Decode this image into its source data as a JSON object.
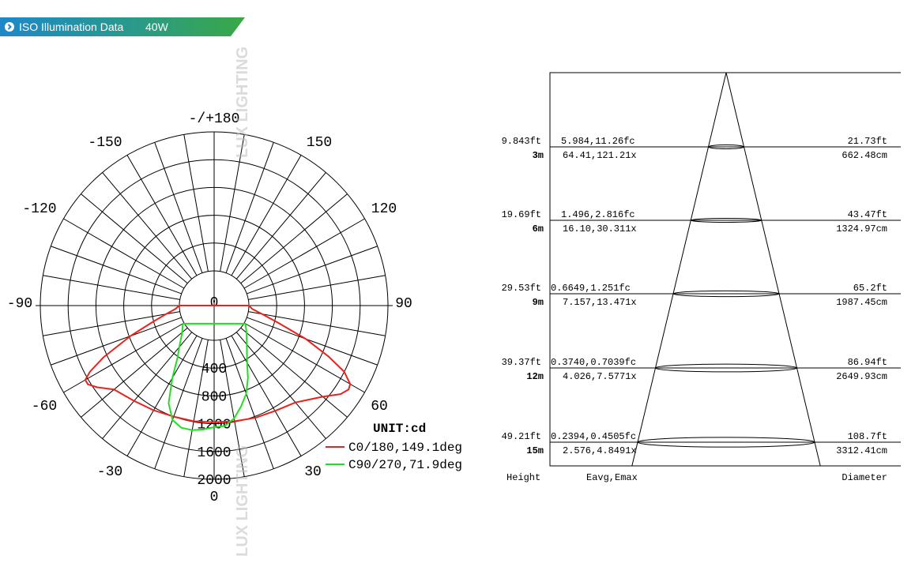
{
  "header": {
    "label": "ISO Illumination  Data",
    "power": "40W",
    "colors": {
      "blue": "#1e88c8",
      "green": "#3aa845"
    }
  },
  "watermark_text": "LUX LIGHTING",
  "chart_data": [
    {
      "type": "polar",
      "angle_labels": [
        {
          "deg": 180,
          "text": "-/+180"
        },
        {
          "deg": 150,
          "text": "150"
        },
        {
          "deg": -150,
          "text": "-150"
        },
        {
          "deg": 120,
          "text": "120"
        },
        {
          "deg": -120,
          "text": "-120"
        },
        {
          "deg": 90,
          "text": "90"
        },
        {
          "deg": -90,
          "text": "-90"
        },
        {
          "deg": 60,
          "text": "60"
        },
        {
          "deg": -60,
          "text": "-60"
        },
        {
          "deg": 30,
          "text": "30"
        },
        {
          "deg": -30,
          "text": "-30"
        },
        {
          "deg": 0,
          "text": "0"
        }
      ],
      "radial_max": 2000,
      "radial_labels": [
        "0",
        "400",
        "800",
        "1200",
        "1600",
        "2000"
      ],
      "radial_values": [
        0,
        400,
        800,
        1200,
        1600,
        2000
      ],
      "unit": "UNIT:cd",
      "series": [
        {
          "name": "C0/180,149.1deg",
          "color": "#e8231f",
          "points": [
            [
              0,
              1180
            ],
            [
              10,
              1190
            ],
            [
              20,
              1220
            ],
            [
              30,
              1250
            ],
            [
              40,
              1320
            ],
            [
              50,
              1540
            ],
            [
              55,
              1720
            ],
            [
              58,
              1780
            ],
            [
              60,
              1760
            ],
            [
              63,
              1600
            ],
            [
              66,
              1300
            ],
            [
              70,
              900
            ],
            [
              75,
              450
            ],
            [
              80,
              200
            ],
            [
              85,
              50
            ],
            [
              90,
              0
            ],
            [
              -90,
              0
            ],
            [
              -85,
              60
            ],
            [
              -80,
              200
            ],
            [
              -75,
              420
            ],
            [
              -70,
              780
            ],
            [
              -65,
              1250
            ],
            [
              -62,
              1520
            ],
            [
              -60,
              1640
            ],
            [
              -58,
              1640
            ],
            [
              -55,
              1550
            ],
            [
              -50,
              1380
            ],
            [
              -40,
              1290
            ],
            [
              -30,
              1240
            ],
            [
              -20,
              1200
            ],
            [
              -10,
              1190
            ]
          ]
        },
        {
          "name": "C90/270,71.9deg",
          "color": "#22dd22",
          "points": [
            [
              0,
              1250
            ],
            [
              5,
              1240
            ],
            [
              10,
              1150
            ],
            [
              15,
              1000
            ],
            [
              20,
              850
            ],
            [
              25,
              650
            ],
            [
              30,
              450
            ],
            [
              40,
              230
            ],
            [
              50,
              110
            ],
            [
              60,
              20
            ],
            [
              -60,
              20
            ],
            [
              -50,
              100
            ],
            [
              -40,
              280
            ],
            [
              -35,
              420
            ],
            [
              -30,
              700
            ],
            [
              -25,
              1050
            ],
            [
              -20,
              1250
            ],
            [
              -15,
              1320
            ],
            [
              -10,
              1320
            ],
            [
              -5,
              1290
            ]
          ]
        }
      ]
    },
    {
      "type": "table",
      "rows": [
        {
          "height_ft": "9.843ft",
          "height_m": "3m",
          "eavg_fc": "5.984,11.26fc",
          "eavg_lx": "64.41,121.21x",
          "diam_ft": "21.73ft",
          "diam_cm": "662.48cm"
        },
        {
          "height_ft": "19.69ft",
          "height_m": "6m",
          "eavg_fc": "1.496,2.816fc",
          "eavg_lx": "16.10,30.311x",
          "diam_ft": "43.47ft",
          "diam_cm": "1324.97cm"
        },
        {
          "height_ft": "29.53ft",
          "height_m": "9m",
          "eavg_fc": "0.6649,1.251fc",
          "eavg_lx": "7.157,13.471x",
          "diam_ft": "65.2ft",
          "diam_cm": "1987.45cm"
        },
        {
          "height_ft": "39.37ft",
          "height_m": "12m",
          "eavg_fc": "0.3740,0.7039fc",
          "eavg_lx": "4.026,7.5771x",
          "diam_ft": "86.94ft",
          "diam_cm": "2649.93cm"
        },
        {
          "height_ft": "49.21ft",
          "height_m": "15m",
          "eavg_fc": "0.2394,0.4505fc",
          "eavg_lx": "2.576,4.8491x",
          "diam_ft": "108.7ft",
          "diam_cm": "3312.41cm"
        }
      ],
      "column_labels": {
        "height": "Height",
        "eavg": "Eavg,Emax",
        "diameter": "Diameter"
      },
      "max_height_m": 15
    }
  ]
}
